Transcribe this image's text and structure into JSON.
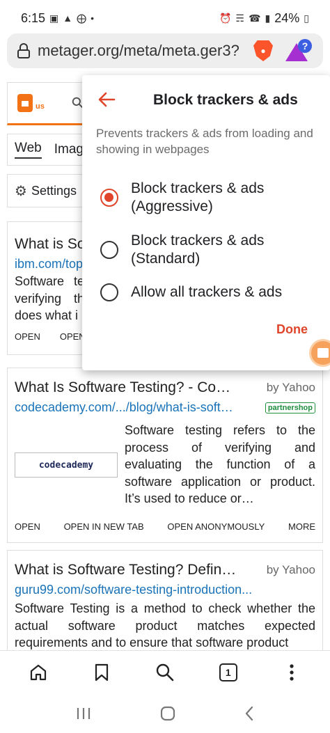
{
  "status_bar": {
    "time": "6:15",
    "battery": "24%"
  },
  "url_bar": {
    "url": "metager.org/meta/meta.ger3?"
  },
  "page": {
    "lang_badge": "us",
    "tabs": [
      "Web",
      "Imag"
    ],
    "settings_label": "Settings"
  },
  "results": [
    {
      "title": "What is So",
      "url": "ibm.com/top",
      "desc": "Software te verifying th does what i",
      "actions": [
        "OPEN",
        "OPEN"
      ]
    },
    {
      "title": "What Is Software Testing? - Co…",
      "source": "by Yahoo",
      "url": "codecademy.com/.../blog/what-is-soft…",
      "badge": "partnershop",
      "thumb_text": "codecademy",
      "desc": "Software testing refers to the process of verifying and evaluating the function of a software application or product. It’s used to reduce or…",
      "actions": [
        "OPEN",
        "OPEN IN NEW TAB",
        "OPEN ANONYMOUSLY",
        "MORE"
      ]
    },
    {
      "title": "What is Software Testing? Defin…",
      "source": "by Yahoo",
      "url": "guru99.com/software-testing-introduction...",
      "desc": "Software Testing is a method to check whether the actual software product matches expected requirements and to ensure that software product"
    }
  ],
  "popup": {
    "title": "Block trackers & ads",
    "subtitle": "Prevents trackers & ads from loading and showing in webpages",
    "options": [
      {
        "label": "Block trackers & ads\n(Aggressive)",
        "selected": true
      },
      {
        "label": "Block trackers & ads\n(Standard)",
        "selected": false
      },
      {
        "label": "Allow all trackers & ads",
        "selected": false
      }
    ],
    "done_label": "Done"
  },
  "bottom_nav": {
    "tab_count": "1"
  },
  "colors": {
    "accent": "#e0442a",
    "metager_orange": "#f47216",
    "link": "#1a73b8",
    "badge_green": "#1e8e3e"
  }
}
